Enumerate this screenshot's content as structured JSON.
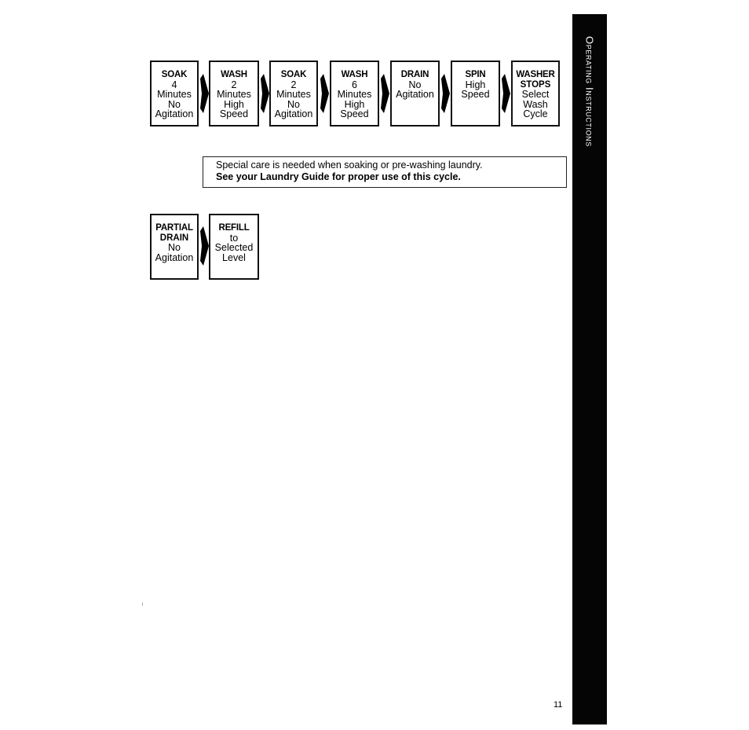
{
  "sidebar": {
    "title": "Operating Instructions"
  },
  "cycle_steps": [
    {
      "head": "SOAK",
      "lines": [
        "4",
        "Minutes",
        "No",
        "Agitation"
      ]
    },
    {
      "head": "WASH",
      "lines": [
        "2",
        "Minutes",
        "High",
        "Speed"
      ]
    },
    {
      "head": "SOAK",
      "lines": [
        "2",
        "Minutes",
        "No",
        "Agitation"
      ]
    },
    {
      "head": "WASH",
      "lines": [
        "6",
        "Minutes",
        "High",
        "Speed"
      ]
    },
    {
      "head": "DRAIN",
      "lines": [
        "No",
        "Agitation"
      ]
    },
    {
      "head": "SPIN",
      "lines": [
        "High",
        "Speed"
      ]
    },
    {
      "head": "WASHER",
      "lines": [
        "STOPS",
        "Select",
        "Wash",
        "Cycle"
      ]
    }
  ],
  "notice": {
    "text": "Special care is needed when soaking or pre-washing laundry.",
    "bold_text": "See your Laundry Guide for proper use of this cycle."
  },
  "sub_steps": [
    {
      "head": "PARTIAL",
      "lines": [
        "DRAIN",
        "No",
        "Agitation"
      ]
    },
    {
      "head": "REFILL",
      "lines": [
        "to",
        "Selected",
        "Level"
      ]
    }
  ],
  "page_number": "11"
}
